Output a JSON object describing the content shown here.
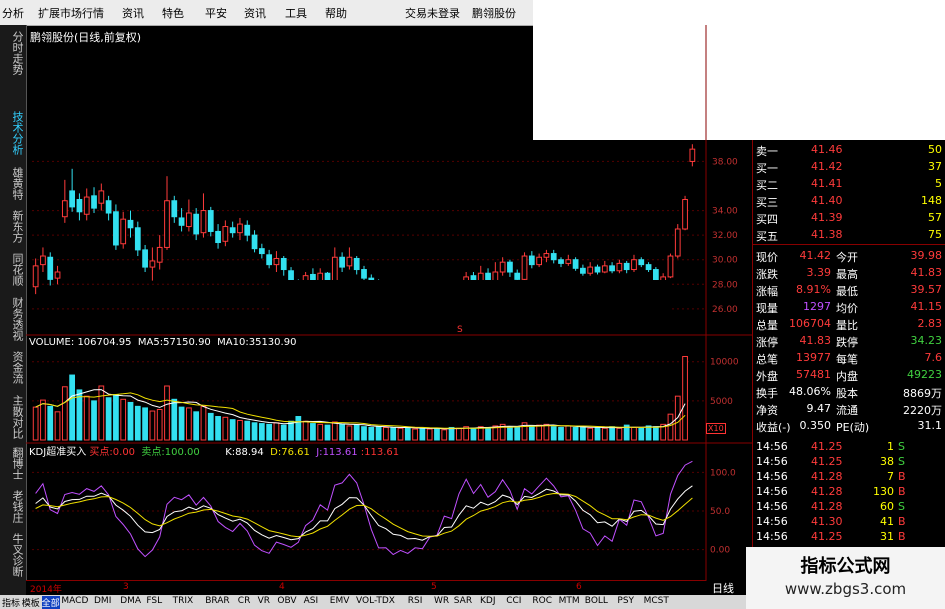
{
  "menu": {
    "items": [
      "分析",
      "扩展市场行情",
      "资讯",
      "特色",
      "平安",
      "资讯",
      "工具",
      "帮助"
    ],
    "login_status": "交易未登录",
    "stock_title": "鹏翎股份"
  },
  "sidebar": {
    "tabs": [
      "分时走势",
      "技术分析",
      "雄黄特",
      "新东方",
      "同花顺",
      "财务透视",
      "资金流",
      "主散对比",
      "翻博士",
      "老钱庄",
      "牛叉诊断"
    ]
  },
  "chart": {
    "title": "鹏翎股份(日线,前复权)",
    "price_ticks": [
      "38.00",
      "34.00",
      "32.00",
      "30.00",
      "28.00",
      "26.00"
    ],
    "volume_ticks": [
      "10000",
      "5000"
    ],
    "volume_unit": "X10",
    "kdj_ticks": [
      "100.0",
      "50.0",
      "0.00"
    ],
    "time_labels": [
      "2014年",
      "3",
      "4",
      "5",
      "6"
    ],
    "period_label": "日线"
  },
  "volume_indicator": {
    "name": "VOLUME",
    "volume": "106704.95",
    "ma5_label": "MA5:",
    "ma5": "57150.90",
    "ma10_label": "MA10:",
    "ma10": "35130.90"
  },
  "kdj_indicator": {
    "name": "KDJ超准买入",
    "buy_label": "买点:",
    "buy": "0.00",
    "sell_label": "卖点:",
    "sell": "100.00",
    "k_label": "K:",
    "k": "88.94",
    "d_label": "D:",
    "d": "76.61",
    "j_label": "J:",
    "j": "113.61",
    "j2": "113.61"
  },
  "order_book": [
    {
      "label": "卖一",
      "price": "41.46",
      "qty": "50"
    },
    {
      "label": "买一",
      "price": "41.42",
      "qty": "37"
    },
    {
      "label": "买二",
      "price": "41.41",
      "qty": "5"
    },
    {
      "label": "买三",
      "price": "41.40",
      "qty": "148"
    },
    {
      "label": "买四",
      "price": "41.39",
      "qty": "57"
    },
    {
      "label": "买五",
      "price": "41.38",
      "qty": "75"
    }
  ],
  "stats": [
    {
      "l1": "现价",
      "v1": "41.42",
      "l2": "今开",
      "v2": "39.98"
    },
    {
      "l1": "涨跌",
      "v1": "3.39",
      "l2": "最高",
      "v2": "41.83"
    },
    {
      "l1": "涨幅",
      "v1": "8.91%",
      "l2": "最低",
      "v2": "39.57"
    },
    {
      "l1": "现量",
      "v1": "1297",
      "l2": "均价",
      "v2": "41.15"
    },
    {
      "l1": "总量",
      "v1": "106704",
      "l2": "量比",
      "v2": "2.83"
    },
    {
      "l1": "涨停",
      "v1": "41.83",
      "l2": "跌停",
      "v2": "34.23"
    },
    {
      "l1": "总笔",
      "v1": "13977",
      "l2": "每笔",
      "v2": "7.6"
    },
    {
      "l1": "外盘",
      "v1": "57481",
      "l2": "内盘",
      "v2": "49223"
    },
    {
      "l1": "换手",
      "v1": "48.06%",
      "l2": "股本",
      "v2": "8869万"
    },
    {
      "l1": "净资",
      "v1": "9.47",
      "l2": "流通",
      "v2": "2220万"
    },
    {
      "l1": "收益(-)",
      "v1": "0.350",
      "l2": "PE(动)",
      "v2": "31.1"
    }
  ],
  "ticks": [
    {
      "time": "14:56",
      "price": "41.25",
      "qty": "1",
      "side": "S"
    },
    {
      "time": "14:56",
      "price": "41.25",
      "qty": "38",
      "side": "S"
    },
    {
      "time": "14:56",
      "price": "41.28",
      "qty": "7",
      "side": "B"
    },
    {
      "time": "14:56",
      "price": "41.28",
      "qty": "130",
      "side": "B"
    },
    {
      "time": "14:56",
      "price": "41.28",
      "qty": "60",
      "side": "S"
    },
    {
      "time": "14:56",
      "price": "41.30",
      "qty": "41",
      "side": "B"
    },
    {
      "time": "14:56",
      "price": "41.25",
      "qty": "31",
      "side": "B"
    }
  ],
  "watermark": {
    "title": "指标公式网",
    "url": "www.zbgs3.com"
  },
  "bottom_tabs": [
    "指标",
    "模板",
    "全部",
    "MACD",
    "DMI",
    "DMA",
    "FSL",
    "TRIX",
    "BRAR",
    "CR",
    "VR",
    "OBV",
    "ASI",
    "EMV",
    "VOL-TDX",
    "RSI",
    "WR",
    "SAR",
    "KDJ",
    "CCI",
    "ROC",
    "MTM",
    "BOLL",
    "PSY",
    "MCST"
  ],
  "colors": {
    "up": "#ff3b3b",
    "down": "#33e0f0",
    "ma_white": "#ffffff",
    "ma_yellow": "#f0e000",
    "ma_purple": "#c050ff",
    "ma_green": "#40d040"
  },
  "chart_data": {
    "type": "candlestick",
    "price_axis": {
      "ylim": [
        25.5,
        39.5
      ],
      "ticks": [
        26,
        28,
        30,
        32,
        34,
        38
      ]
    },
    "candles": [
      {
        "o": 27.8,
        "c": 29.5,
        "h": 30.1,
        "l": 27.2
      },
      {
        "o": 29.6,
        "c": 30.3,
        "h": 31.0,
        "l": 29.0
      },
      {
        "o": 30.2,
        "c": 28.4,
        "h": 30.6,
        "l": 27.9
      },
      {
        "o": 28.5,
        "c": 29.0,
        "h": 29.5,
        "l": 28.0
      },
      {
        "o": 33.5,
        "c": 34.8,
        "h": 36.5,
        "l": 33.0
      },
      {
        "o": 35.6,
        "c": 34.3,
        "h": 37.4,
        "l": 33.9
      },
      {
        "o": 34.9,
        "c": 33.9,
        "h": 35.4,
        "l": 33.2
      },
      {
        "o": 33.7,
        "c": 35.1,
        "h": 35.8,
        "l": 33.2
      },
      {
        "o": 35.2,
        "c": 34.2,
        "h": 35.9,
        "l": 33.8
      },
      {
        "o": 34.6,
        "c": 35.6,
        "h": 36.2,
        "l": 34.0
      },
      {
        "o": 34.8,
        "c": 33.8,
        "h": 35.2,
        "l": 33.2
      },
      {
        "o": 33.9,
        "c": 31.2,
        "h": 34.5,
        "l": 30.8
      },
      {
        "o": 31.3,
        "c": 33.3,
        "h": 33.9,
        "l": 30.9
      },
      {
        "o": 33.2,
        "c": 32.6,
        "h": 34.0,
        "l": 31.8
      },
      {
        "o": 32.6,
        "c": 30.8,
        "h": 33.1,
        "l": 30.3
      },
      {
        "o": 30.8,
        "c": 29.4,
        "h": 31.2,
        "l": 29.0
      },
      {
        "o": 29.4,
        "c": 29.9,
        "h": 31.0,
        "l": 28.3
      },
      {
        "o": 29.8,
        "c": 31.0,
        "h": 32.0,
        "l": 29.2
      },
      {
        "o": 31.0,
        "c": 34.8,
        "h": 36.8,
        "l": 30.8
      },
      {
        "o": 34.8,
        "c": 33.5,
        "h": 35.2,
        "l": 33.0
      },
      {
        "o": 33.4,
        "c": 32.8,
        "h": 34.2,
        "l": 32.3
      },
      {
        "o": 32.7,
        "c": 33.8,
        "h": 34.9,
        "l": 32.3
      },
      {
        "o": 33.7,
        "c": 32.1,
        "h": 34.2,
        "l": 31.6
      },
      {
        "o": 32.2,
        "c": 34.0,
        "h": 35.4,
        "l": 31.8
      },
      {
        "o": 34.0,
        "c": 32.3,
        "h": 34.3,
        "l": 31.9
      },
      {
        "o": 32.3,
        "c": 31.4,
        "h": 32.9,
        "l": 30.9
      },
      {
        "o": 31.5,
        "c": 32.7,
        "h": 33.2,
        "l": 31.1
      },
      {
        "o": 32.6,
        "c": 32.2,
        "h": 33.1,
        "l": 31.8
      },
      {
        "o": 32.2,
        "c": 32.9,
        "h": 33.4,
        "l": 31.6
      },
      {
        "o": 32.8,
        "c": 32.0,
        "h": 33.2,
        "l": 31.5
      },
      {
        "o": 32.0,
        "c": 30.9,
        "h": 32.4,
        "l": 30.6
      },
      {
        "o": 30.9,
        "c": 30.5,
        "h": 31.3,
        "l": 30.1
      },
      {
        "o": 30.4,
        "c": 29.6,
        "h": 30.8,
        "l": 29.3
      },
      {
        "o": 29.6,
        "c": 30.1,
        "h": 30.7,
        "l": 29.0
      },
      {
        "o": 30.1,
        "c": 29.2,
        "h": 30.3,
        "l": 28.7
      },
      {
        "o": 29.1,
        "c": 28.2,
        "h": 29.4,
        "l": 27.8
      },
      {
        "o": 28.2,
        "c": 27.0,
        "h": 28.4,
        "l": 25.7
      },
      {
        "o": 27.2,
        "c": 28.7,
        "h": 29.0,
        "l": 26.9
      },
      {
        "o": 28.8,
        "c": 28.1,
        "h": 29.3,
        "l": 27.8
      },
      {
        "o": 28.2,
        "c": 28.9,
        "h": 29.3,
        "l": 27.7
      },
      {
        "o": 28.9,
        "c": 27.6,
        "h": 29.0,
        "l": 27.4
      },
      {
        "o": 27.8,
        "c": 30.2,
        "h": 31.0,
        "l": 27.6
      },
      {
        "o": 30.2,
        "c": 29.4,
        "h": 30.6,
        "l": 29.0
      },
      {
        "o": 29.5,
        "c": 30.2,
        "h": 31.0,
        "l": 29.2
      },
      {
        "o": 30.1,
        "c": 29.2,
        "h": 30.3,
        "l": 28.8
      },
      {
        "o": 29.2,
        "c": 28.5,
        "h": 29.5,
        "l": 28.2
      },
      {
        "o": 28.5,
        "c": 28.0,
        "h": 28.8,
        "l": 27.6
      },
      {
        "o": 28.0,
        "c": 27.6,
        "h": 28.4,
        "l": 27.4
      },
      {
        "o": 27.6,
        "c": 28.0,
        "h": 28.3,
        "l": 27.3
      },
      {
        "o": 28.0,
        "c": 27.4,
        "h": 28.2,
        "l": 27.2
      },
      {
        "o": 27.4,
        "c": 27.7,
        "h": 28.0,
        "l": 27.1
      },
      {
        "o": 27.6,
        "c": 27.2,
        "h": 27.9,
        "l": 27.0
      },
      {
        "o": 27.2,
        "c": 27.5,
        "h": 27.8,
        "l": 27.0
      },
      {
        "o": 27.5,
        "c": 27.1,
        "h": 27.7,
        "l": 26.9
      },
      {
        "o": 27.1,
        "c": 27.4,
        "h": 27.6,
        "l": 26.9
      },
      {
        "o": 27.4,
        "c": 27.2,
        "h": 27.6,
        "l": 27.0
      },
      {
        "o": 27.2,
        "c": 27.6,
        "h": 27.9,
        "l": 27.0
      },
      {
        "o": 27.6,
        "c": 27.3,
        "h": 27.8,
        "l": 27.1
      },
      {
        "o": 27.3,
        "c": 27.8,
        "h": 28.1,
        "l": 27.2
      },
      {
        "o": 27.8,
        "c": 28.6,
        "h": 29.0,
        "l": 27.6
      },
      {
        "o": 28.7,
        "c": 27.9,
        "h": 29.0,
        "l": 27.6
      },
      {
        "o": 27.9,
        "c": 28.9,
        "h": 29.5,
        "l": 27.8
      },
      {
        "o": 28.9,
        "c": 28.2,
        "h": 29.3,
        "l": 27.9
      },
      {
        "o": 28.2,
        "c": 29.0,
        "h": 29.8,
        "l": 28.0
      },
      {
        "o": 29.0,
        "c": 29.8,
        "h": 30.2,
        "l": 28.7
      },
      {
        "o": 29.8,
        "c": 29.0,
        "h": 30.0,
        "l": 28.6
      },
      {
        "o": 28.9,
        "c": 28.4,
        "h": 29.2,
        "l": 28.0
      },
      {
        "o": 28.4,
        "c": 30.3,
        "h": 30.6,
        "l": 28.2
      },
      {
        "o": 30.3,
        "c": 29.6,
        "h": 30.7,
        "l": 29.3
      },
      {
        "o": 29.6,
        "c": 30.2,
        "h": 30.5,
        "l": 29.4
      },
      {
        "o": 30.2,
        "c": 30.5,
        "h": 30.8,
        "l": 29.8
      },
      {
        "o": 30.5,
        "c": 30.0,
        "h": 30.8,
        "l": 29.7
      },
      {
        "o": 30.0,
        "c": 29.7,
        "h": 30.2,
        "l": 29.4
      },
      {
        "o": 29.7,
        "c": 30.0,
        "h": 30.4,
        "l": 29.5
      },
      {
        "o": 30.0,
        "c": 29.3,
        "h": 30.2,
        "l": 29.1
      },
      {
        "o": 29.3,
        "c": 28.9,
        "h": 29.6,
        "l": 28.7
      },
      {
        "o": 28.9,
        "c": 29.4,
        "h": 29.8,
        "l": 28.7
      },
      {
        "o": 29.4,
        "c": 29.0,
        "h": 29.6,
        "l": 28.8
      },
      {
        "o": 29.0,
        "c": 29.5,
        "h": 29.9,
        "l": 28.9
      },
      {
        "o": 29.5,
        "c": 29.1,
        "h": 29.8,
        "l": 28.9
      },
      {
        "o": 29.1,
        "c": 29.7,
        "h": 30.0,
        "l": 28.9
      },
      {
        "o": 29.7,
        "c": 29.2,
        "h": 29.9,
        "l": 28.9
      },
      {
        "o": 29.2,
        "c": 30.0,
        "h": 30.4,
        "l": 29.0
      },
      {
        "o": 30.0,
        "c": 29.6,
        "h": 30.2,
        "l": 29.4
      },
      {
        "o": 29.6,
        "c": 29.2,
        "h": 29.8,
        "l": 29.0
      },
      {
        "o": 29.2,
        "c": 28.2,
        "h": 29.4,
        "l": 27.9
      },
      {
        "o": 28.2,
        "c": 28.6,
        "h": 28.9,
        "l": 27.8
      },
      {
        "o": 28.6,
        "c": 30.3,
        "h": 30.5,
        "l": 28.5
      },
      {
        "o": 30.3,
        "c": 32.5,
        "h": 32.9,
        "l": 30.1
      },
      {
        "o": 32.5,
        "c": 34.9,
        "h": 35.2,
        "l": 32.4
      },
      {
        "o": 38.0,
        "c": 39.0,
        "h": 39.4,
        "l": 37.6
      }
    ],
    "volumes": [
      4200,
      5100,
      4300,
      3600,
      6800,
      8300,
      6400,
      5600,
      5000,
      6900,
      5400,
      5800,
      5200,
      4800,
      4300,
      4100,
      3700,
      3900,
      6900,
      5200,
      4200,
      4100,
      3600,
      4300,
      3400,
      3000,
      2900,
      2600,
      2500,
      2400,
      2200,
      2100,
      2000,
      2200,
      1900,
      2400,
      3000,
      2400,
      2100,
      2000,
      1900,
      2300,
      2000,
      1800,
      1900,
      1700,
      1600,
      1700,
      1600,
      1600,
      1500,
      1600,
      1400,
      1500,
      1400,
      1500,
      1300,
      1600,
      1500,
      1700,
      1500,
      1700,
      1600,
      1800,
      2000,
      1700,
      1600,
      2200,
      1800,
      1900,
      2000,
      1700,
      1600,
      1800,
      1600,
      1700,
      1500,
      1600,
      1500,
      1700,
      1500,
      1900,
      1600,
      1500,
      1800,
      1700,
      2000,
      3300,
      5600,
      10670
    ],
    "volume_axis": {
      "ylim": [
        0,
        11500
      ],
      "ticks": [
        5000,
        10000
      ]
    },
    "kdj_axis": {
      "ylim": [
        -20,
        120
      ],
      "ticks": [
        0,
        50,
        100
      ]
    }
  }
}
